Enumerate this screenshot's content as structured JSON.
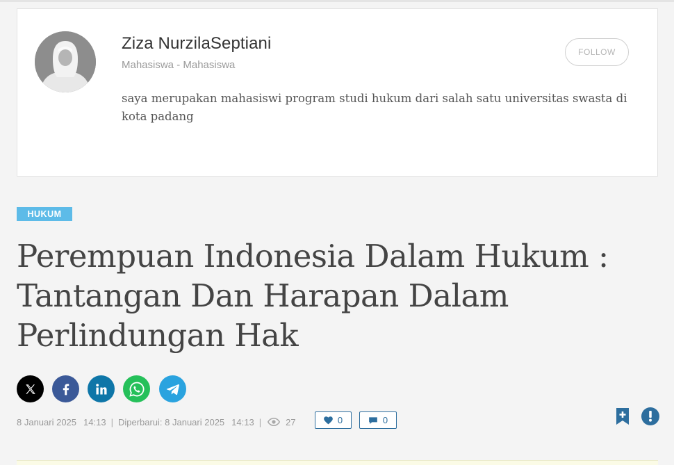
{
  "author": {
    "name": "Ziza NurzilaSeptiani",
    "role": "Mahasiswa - Mahasiswa",
    "bio": "saya merupakan mahasiswi program studi hukum dari salah satu universitas swasta di kota padang",
    "follow_label": "FOLLOW",
    "avatar_icon": "hijab-woman-avatar"
  },
  "article": {
    "category": "HUKUM",
    "title": "Perempuan Indonesia Dalam Hukum : Tantangan Dan Harapan Dalam Perlindungan Hak",
    "published_date": "8 Januari 2025",
    "published_time": "14:13",
    "updated_label": "Diperbarui: 8 Januari 2025",
    "updated_time": "14:13",
    "separator": "|",
    "views": "27",
    "likes": "0",
    "comments": "0"
  },
  "share": {
    "icons": [
      "x-icon",
      "facebook-icon",
      "linkedin-icon",
      "whatsapp-icon",
      "telegram-icon"
    ]
  },
  "colors": {
    "category_bg": "#5dbbe8",
    "accent": "#2d6e9e",
    "facebook": "#3b5998",
    "linkedin": "#0e76a8",
    "whatsapp": "#25c05a",
    "telegram": "#2aa3df"
  }
}
